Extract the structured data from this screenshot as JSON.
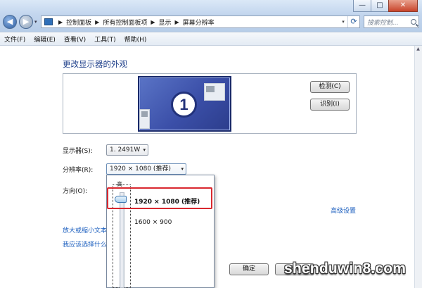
{
  "window": {
    "minimize_glyph": "—",
    "maximize_glyph": "□",
    "close_glyph": "✕"
  },
  "nav": {
    "back_glyph": "◀",
    "forward_glyph": "▶",
    "history_glyph": "▾"
  },
  "address_bar": {
    "breadcrumbs": [
      "控制面板",
      "所有控制面板项",
      "显示",
      "屏幕分辨率"
    ],
    "separator": "▶",
    "dropdown_glyph": "▾",
    "refresh_glyph": "⟳"
  },
  "search": {
    "placeholder": "搜索控制..."
  },
  "menubar": {
    "items": [
      "文件(F)",
      "编辑(E)",
      "查看(V)",
      "工具(T)",
      "帮助(H)"
    ]
  },
  "page": {
    "title": "更改显示器的外观",
    "monitor_number": "1",
    "detect_button": "检测(C)",
    "identify_button": "识别(I)",
    "display_label": "显示器(S):",
    "display_value": "1. 2491W",
    "resolution_label": "分辨率(R):",
    "resolution_value": "1920 × 1080 (推荐)",
    "orientation_label": "方向(O):",
    "advanced_link": "高级设置",
    "text_size_link": "放大或缩小文本",
    "choose_link": "我应该选择什么",
    "combo_arrow": "▾"
  },
  "resolution_dropdown": {
    "high_label": "高",
    "options": [
      "1920 × 1080 (推荐)",
      "1600 × 900"
    ],
    "selected_index": 0
  },
  "footer": {
    "ok_button": "确定",
    "cancel_button": "取消"
  },
  "watermark": {
    "text": "shenduwin8.com"
  },
  "colors": {
    "link": "#1c5fbf",
    "title": "#1e3f8a",
    "highlight_border": "#d9282f",
    "monitor": "#3b4fa8"
  }
}
